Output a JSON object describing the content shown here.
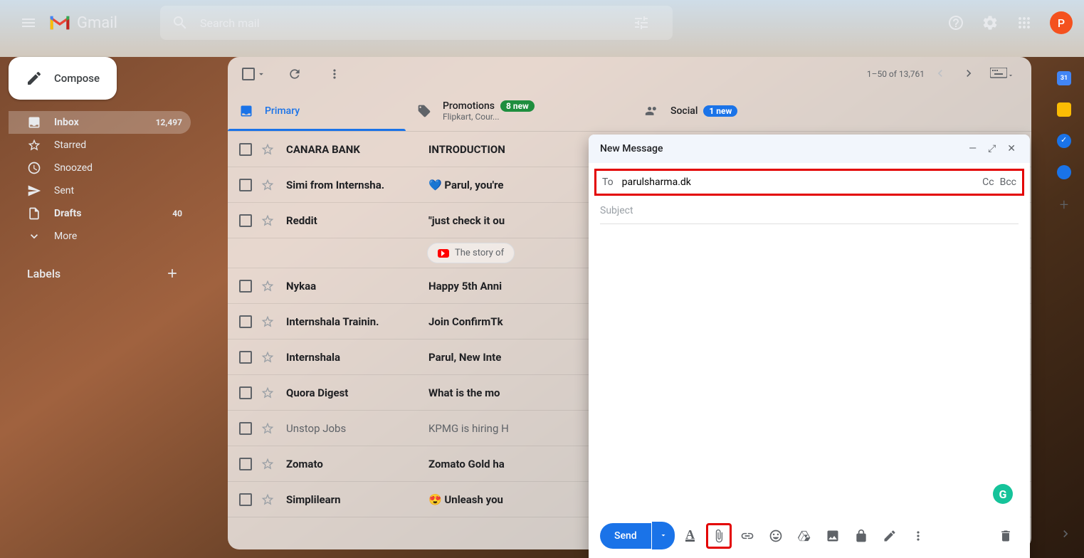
{
  "header": {
    "product": "Gmail",
    "search_placeholder": "Search mail",
    "avatar_letter": "P"
  },
  "sidebar": {
    "compose": "Compose",
    "items": [
      {
        "label": "Inbox",
        "count": "12,497",
        "icon": "inbox"
      },
      {
        "label": "Starred",
        "count": "",
        "icon": "star"
      },
      {
        "label": "Snoozed",
        "count": "",
        "icon": "clock"
      },
      {
        "label": "Sent",
        "count": "",
        "icon": "send"
      },
      {
        "label": "Drafts",
        "count": "40",
        "icon": "file"
      },
      {
        "label": "More",
        "count": "",
        "icon": "expand"
      }
    ],
    "labels_heading": "Labels"
  },
  "toolbar": {
    "range": "1–50 of 13,761"
  },
  "tabs": {
    "primary": "Primary",
    "promotions": {
      "label": "Promotions",
      "badge": "8 new",
      "sub": "Flipkart, Cour..."
    },
    "social": {
      "label": "Social",
      "badge": "1 new"
    }
  },
  "emails": [
    {
      "sender": "CANARA BANK",
      "subject": "INTRODUCTION",
      "read": false
    },
    {
      "sender": "Simi from Internsha.",
      "subject": "💙 Parul, you're",
      "read": false
    },
    {
      "sender": "Reddit",
      "subject": "\"just check it ou",
      "read": false
    },
    {
      "sender": "Nykaa",
      "subject": "Happy 5th Anni",
      "read": false
    },
    {
      "sender": "Internshala Trainin.",
      "subject": "Join ConfirmTk",
      "read": false
    },
    {
      "sender": "Internshala",
      "subject": "Parul, New Inte",
      "read": false
    },
    {
      "sender": "Quora Digest",
      "subject": "What is the mo",
      "read": false
    },
    {
      "sender": "Unstop Jobs",
      "subject": "KPMG is hiring H",
      "read": true
    },
    {
      "sender": "Zomato",
      "subject": "Zomato Gold ha",
      "read": false
    },
    {
      "sender": "Simplilearn",
      "subject": "😍 Unleash you",
      "read": false
    }
  ],
  "chip": "The story of",
  "compose_window": {
    "title": "New Message",
    "to_label": "To",
    "to_value": "parulsharma.dk",
    "cc": "Cc",
    "bcc": "Bcc",
    "subject_placeholder": "Subject",
    "send": "Send"
  },
  "calendar_day": "31"
}
